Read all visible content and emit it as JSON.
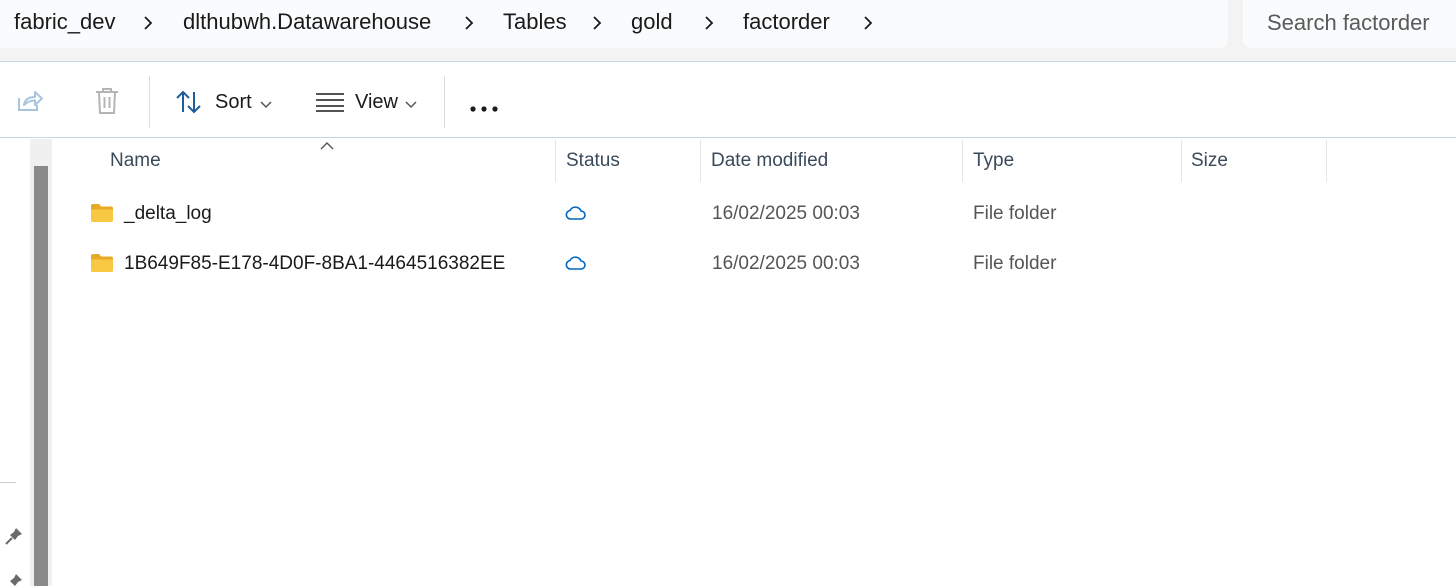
{
  "breadcrumb": {
    "items": [
      "fabric_dev",
      "dlthubwh.Datawarehouse",
      "Tables",
      "gold",
      "factorder"
    ]
  },
  "search": {
    "placeholder": "Search factorder"
  },
  "toolbar": {
    "share_icon": "share-icon",
    "delete_icon": "trash-icon",
    "sort_label": "Sort",
    "view_label": "View",
    "more_icon": "more-icon"
  },
  "columns": {
    "name": "Name",
    "status": "Status",
    "date_modified": "Date modified",
    "type": "Type",
    "size": "Size"
  },
  "files": [
    {
      "name": "_delta_log",
      "status": "cloud-icon",
      "date_modified": "16/02/2025 00:03",
      "type": "File folder",
      "size": ""
    },
    {
      "name": "1B649F85-E178-4D0F-8BA1-4464516382EE",
      "status": "cloud-icon",
      "date_modified": "16/02/2025 00:03",
      "type": "File folder",
      "size": ""
    }
  ],
  "colors": {
    "accent": "#0067c0",
    "folder": "#f8c842",
    "header_text": "#3b4a5a"
  }
}
